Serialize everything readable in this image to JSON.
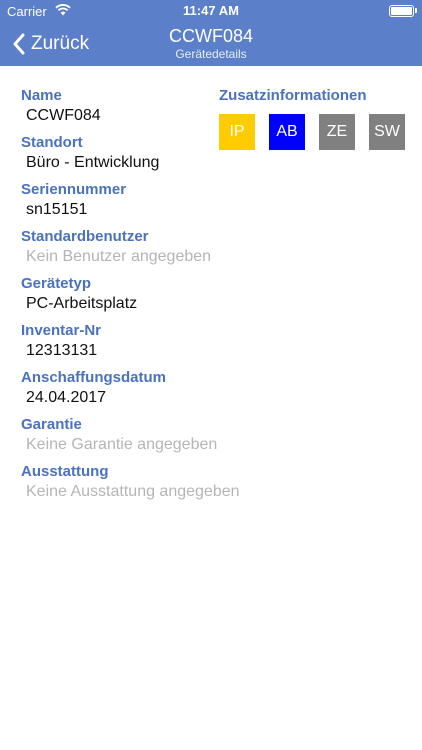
{
  "status_bar": {
    "carrier": "Carrier",
    "time": "11:47 AM"
  },
  "nav": {
    "back_label": "Zurück",
    "title": "CCWF084",
    "subtitle": "Gerätedetails"
  },
  "fields": [
    {
      "label": "Name",
      "value": "CCWF084"
    },
    {
      "label": "Standort",
      "value": "Büro - Entwicklung"
    },
    {
      "label": "Seriennummer",
      "value": "sn15151"
    },
    {
      "label": "Standardbenutzer",
      "value": "Kein Benutzer angegeben"
    },
    {
      "label": "Gerätetyp",
      "value": "PC-Arbeitsplatz"
    },
    {
      "label": "Inventar-Nr",
      "value": "12313131"
    },
    {
      "label": "Anschaffungsdatum",
      "value": "24.04.2017"
    },
    {
      "label": "Garantie",
      "value": "Keine Garantie angegeben"
    },
    {
      "label": "Ausstattung",
      "value": "Keine Ausstattung angegeben"
    }
  ],
  "extra": {
    "heading": "Zusatzinformationen",
    "tags": [
      {
        "label": "IP",
        "color": "#ffcc00"
      },
      {
        "label": "AB",
        "color": "#0000ff"
      },
      {
        "label": "ZE",
        "color": "#808080"
      },
      {
        "label": "SW",
        "color": "#808080"
      }
    ]
  },
  "colors": {
    "header": "#5b80c9",
    "label": "#4a72bd",
    "placeholder": "#b5b5b5"
  }
}
